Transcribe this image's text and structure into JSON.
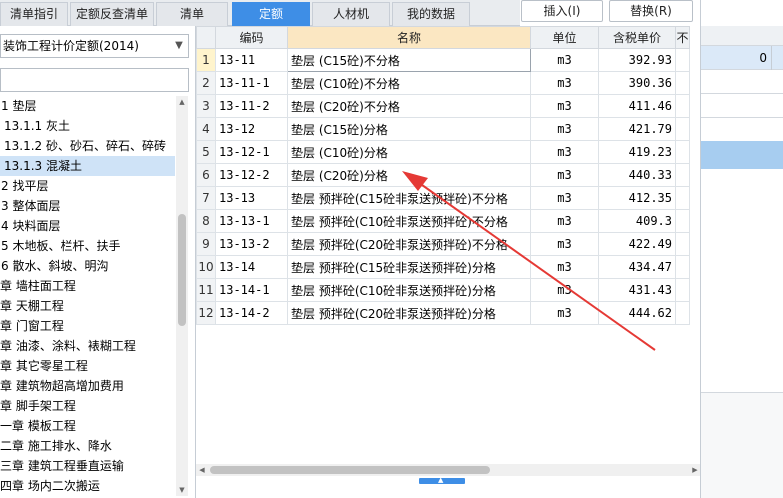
{
  "tabs": [
    {
      "label": "清单指引",
      "active": false
    },
    {
      "label": "定额反查清单",
      "active": false
    },
    {
      "label": "清单",
      "active": false
    },
    {
      "label": "定额",
      "active": true
    },
    {
      "label": "人材机",
      "active": false
    },
    {
      "label": "我的数据",
      "active": false
    }
  ],
  "toolbar": {
    "insert_label": "插入(I)",
    "replace_label": "替换(R)"
  },
  "library": {
    "selected": "装饰工程计价定额(2014)",
    "search_value": ""
  },
  "tree": [
    {
      "label": "1 垫层",
      "selected": false
    },
    {
      "label": "13.1.1 灰土",
      "selected": false
    },
    {
      "label": "13.1.2 砂、砂石、碎石、碎砖",
      "selected": false
    },
    {
      "label": "13.1.3 混凝土",
      "selected": true
    },
    {
      "label": "2 找平层",
      "selected": false
    },
    {
      "label": "3 整体面层",
      "selected": false
    },
    {
      "label": "4 块料面层",
      "selected": false
    },
    {
      "label": "5 木地板、栏杆、扶手",
      "selected": false
    },
    {
      "label": "6 散水、斜坡、明沟",
      "selected": false
    },
    {
      "label": "章 墙柱面工程",
      "selected": false
    },
    {
      "label": "章 天棚工程",
      "selected": false
    },
    {
      "label": "章 门窗工程",
      "selected": false
    },
    {
      "label": "章 油漆、涂料、裱糊工程",
      "selected": false
    },
    {
      "label": "章 其它零星工程",
      "selected": false
    },
    {
      "label": "章 建筑物超高增加费用",
      "selected": false
    },
    {
      "label": "章 脚手架工程",
      "selected": false
    },
    {
      "label": "一章 模板工程",
      "selected": false
    },
    {
      "label": "二章 施工排水、降水",
      "selected": false
    },
    {
      "label": "三章 建筑工程垂直运输",
      "selected": false
    },
    {
      "label": "四章 场内二次搬运",
      "selected": false
    }
  ],
  "table": {
    "columns": {
      "code": "编码",
      "name": "名称",
      "unit": "单位",
      "price": "含税单价",
      "extra": "不"
    },
    "rows": [
      {
        "n": "1",
        "code": "13-11",
        "name": "垫层 (C15砼)不分格",
        "unit": "m3",
        "price": "392.93"
      },
      {
        "n": "2",
        "code": "13-11-1",
        "name": "垫层 (C10砼)不分格",
        "unit": "m3",
        "price": "390.36"
      },
      {
        "n": "3",
        "code": "13-11-2",
        "name": "垫层 (C20砼)不分格",
        "unit": "m3",
        "price": "411.46"
      },
      {
        "n": "4",
        "code": "13-12",
        "name": "垫层 (C15砼)分格",
        "unit": "m3",
        "price": "421.79"
      },
      {
        "n": "5",
        "code": "13-12-1",
        "name": "垫层 (C10砼)分格",
        "unit": "m3",
        "price": "419.23"
      },
      {
        "n": "6",
        "code": "13-12-2",
        "name": "垫层 (C20砼)分格",
        "unit": "m3",
        "price": "440.33"
      },
      {
        "n": "7",
        "code": "13-13",
        "name": "垫层 预拌砼(C15砼非泵送预拌砼)不分格",
        "unit": "m3",
        "price": "412.35"
      },
      {
        "n": "8",
        "code": "13-13-1",
        "name": "垫层 预拌砼(C10砼非泵送预拌砼)不分格",
        "unit": "m3",
        "price": "409.3"
      },
      {
        "n": "9",
        "code": "13-13-2",
        "name": "垫层 预拌砼(C20砼非泵送预拌砼)不分格",
        "unit": "m3",
        "price": "422.49"
      },
      {
        "n": "10",
        "code": "13-14",
        "name": "垫层 预拌砼(C15砼非泵送预拌砼)分格",
        "unit": "m3",
        "price": "434.47"
      },
      {
        "n": "11",
        "code": "13-14-1",
        "name": "垫层 预拌砼(C10砼非泵送预拌砼)分格",
        "unit": "m3",
        "price": "431.43"
      },
      {
        "n": "12",
        "code": "13-14-2",
        "name": "垫层 预拌砼(C20砼非泵送预拌砼)分格",
        "unit": "m3",
        "price": "444.62"
      }
    ]
  },
  "right_panel": {
    "value": "0"
  },
  "icons": {
    "dropdown": "chevron-down-icon",
    "annotation": "red-arrow-icon"
  },
  "colors": {
    "accent": "#3e8ee6",
    "header_highlight": "#fbe7c2",
    "arrow": "#e53935",
    "selection": "#cfe3f7"
  }
}
